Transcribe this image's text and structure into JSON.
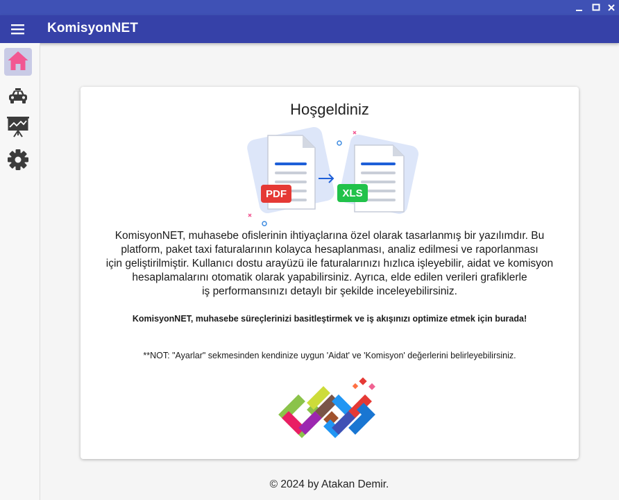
{
  "window": {
    "minimize_icon": "minimize-icon",
    "maximize_icon": "maximize-icon",
    "close_icon": "close-icon"
  },
  "appbar": {
    "title": "KomisyonNET",
    "menu_icon": "hamburger-menu-icon",
    "color": "#3641a8"
  },
  "sidebar": {
    "items": [
      {
        "id": "home",
        "icon": "home-icon",
        "active": true,
        "color": "#f25792"
      },
      {
        "id": "taxi",
        "icon": "taxi-icon",
        "active": false
      },
      {
        "id": "charts",
        "icon": "chart-board-icon",
        "active": false
      },
      {
        "id": "settings",
        "icon": "gear-icon",
        "active": false
      }
    ]
  },
  "main": {
    "welcome_title": "Hoşgeldiniz",
    "illustration": {
      "left_badge": "PDF",
      "right_badge": "XLS",
      "pdf_color": "#e53935",
      "xls_color": "#21c24a"
    },
    "description_lines": [
      "KomisyonNET, muhasebe ofislerinin ihtiyaçlarına özel olarak tasarlanmış bir yazılımdır. Bu",
      "platform, paket taxi faturalarının kolayca hesaplanması, analiz edilmesi ve raporlanması",
      "için geliştirilmiştir. Kullanıcı dostu arayüzü ile faturalarınızı hızlıca işleyebilir, aidat ve komisyon",
      "hesaplamalarını otomatik olarak yapabilirsiniz. Ayrıca, elde edilen verileri grafiklerle",
      "iş performansınızı detaylı bir şekilde inceleyebilirsiniz."
    ],
    "tagline": "KomisyonNET, muhasebe süreçlerinizi basitleştirmek ve iş akışınızı optimize etmek için burada!",
    "note": "**NOT: \"Ayarlar\" sekmesinden kendinize uygun 'Aidat' ve 'Komisyon' değerlerini belirleyebilirsiniz."
  },
  "footer": {
    "copyright": "© 2024 by Atakan Demir."
  }
}
